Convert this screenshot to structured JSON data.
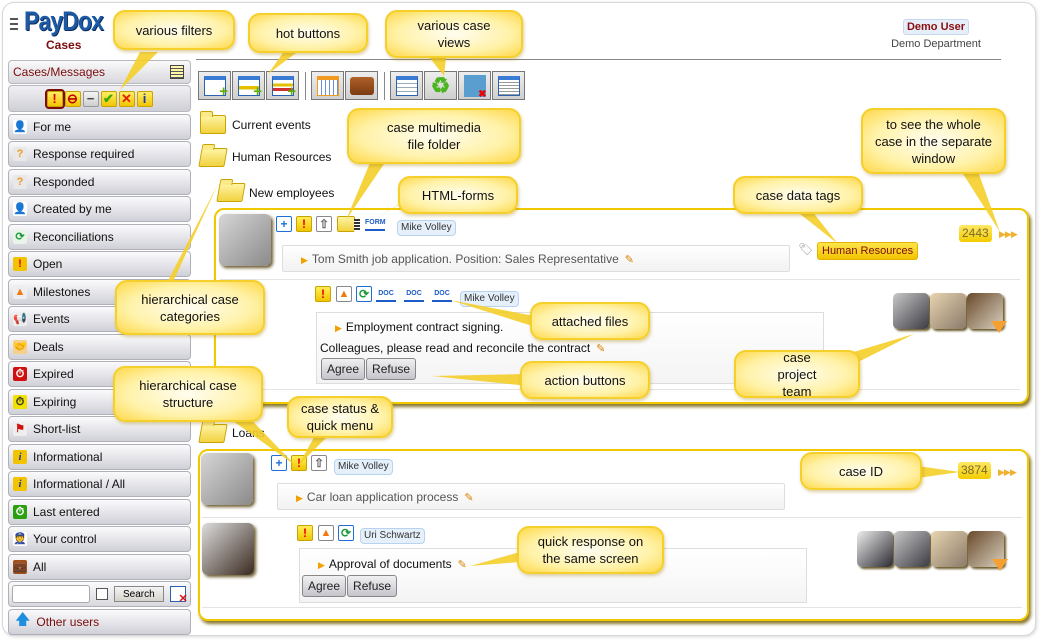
{
  "header": {
    "brand": "PayDox",
    "section": "Cases",
    "user_name": "Demo User",
    "user_department": "Demo Department"
  },
  "sidebar": {
    "title": "Cases/Messages",
    "filters": [
      {
        "icon": "exclamation-icon",
        "glyph": "!",
        "color": "#e00000",
        "selected": true
      },
      {
        "icon": "no-entry-icon",
        "glyph": "⊖",
        "color": "#c00000"
      },
      {
        "icon": "minus-icon",
        "glyph": "−",
        "color": "#444444"
      },
      {
        "icon": "check-icon",
        "glyph": "✔",
        "color": "#3aaa00"
      },
      {
        "icon": "cross-icon",
        "glyph": "✕",
        "color": "#e02000"
      },
      {
        "icon": "info-icon",
        "glyph": "i",
        "color": "#1d3ab0"
      }
    ],
    "items": [
      {
        "label": "For me",
        "icon": "user-icon"
      },
      {
        "label": "Response required",
        "icon": "question-icon"
      },
      {
        "label": "Responded",
        "icon": "question-check-icon"
      },
      {
        "label": "Created by me",
        "icon": "user-icon"
      },
      {
        "label": "Reconciliations",
        "icon": "sync-icon"
      },
      {
        "label": "Open",
        "icon": "exclamation-icon"
      },
      {
        "label": "Milestones",
        "icon": "cone-icon"
      },
      {
        "label": "Events",
        "icon": "megaphone-icon"
      },
      {
        "label": "Deals",
        "icon": "handshake-icon"
      },
      {
        "label": "Expired",
        "icon": "clock-red-icon"
      },
      {
        "label": "Expiring",
        "icon": "clock-yellow-icon"
      },
      {
        "label": "Short-list",
        "icon": "flag-icon"
      },
      {
        "label": "Informational",
        "icon": "info-icon"
      },
      {
        "label": "Informational / All",
        "icon": "info-icon"
      },
      {
        "label": "Last entered",
        "icon": "clock-green-icon"
      },
      {
        "label": "Your control",
        "icon": "controller-icon"
      },
      {
        "label": "All",
        "icon": "briefcase-icon"
      }
    ],
    "search": {
      "value": "",
      "placeholder": "",
      "button": "Search"
    },
    "other_users": "Other users"
  },
  "toolbar": {
    "hot_buttons": [
      "new-message-icon",
      "new-case-icon",
      "new-subcase-icon"
    ],
    "tools": [
      "calendar-icon",
      "briefcase-icon"
    ],
    "views": [
      "table-view-icon",
      "refresh-icon",
      "user-remove-icon",
      "list-view-icon"
    ]
  },
  "tree": {
    "current_events": "Current events",
    "human_resources": "Human Resources",
    "new_employees": "New employees",
    "loans": "Loans"
  },
  "cases": [
    {
      "id": "2443",
      "author": "Mike Volley",
      "subject": "Tom Smith job application. Position: Sales Representative",
      "tag": "Human Resources",
      "subcase": {
        "author": "Mike Volley",
        "attachments": [
          "DOC",
          "DOC",
          "DOC"
        ],
        "title": "Employment contract signing.",
        "message": "Colleagues, please read and reconcile the contract",
        "actions": [
          "Agree",
          "Refuse"
        ],
        "team_size": 3
      }
    },
    {
      "id": "3874",
      "author": "Mike Volley",
      "subject": "Car loan application process",
      "subcase": {
        "author": "Uri Schwartz",
        "title": "Approval of documents",
        "actions": [
          "Agree",
          "Refuse"
        ],
        "team_size": 4
      }
    }
  ],
  "form_icon_label": "FORM",
  "callouts": {
    "filters": "various filters",
    "hot_buttons": "hot buttons",
    "case_views": "various case views",
    "multimedia": "case multimedia file folder",
    "html_forms": "HTML-forms",
    "data_tags": "case data tags",
    "whole_case": "to see the whole case in the separate window",
    "hier_categories": "hierarchical case categories",
    "attached_files": "attached files",
    "action_buttons": "action buttons",
    "project_team": "case project team",
    "hier_structure": "hierarchical case structure",
    "status_menu": "case status & quick menu",
    "case_id": "case ID",
    "quick_response": "quick response on the same screen"
  }
}
